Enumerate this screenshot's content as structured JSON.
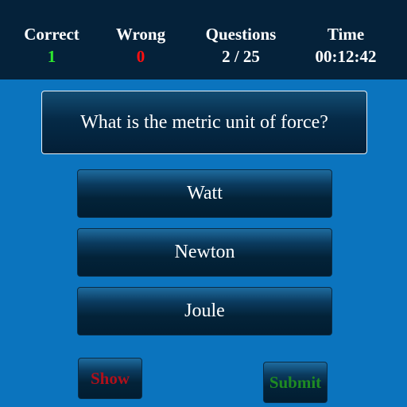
{
  "stats": {
    "correct": {
      "label": "Correct",
      "value": "1",
      "color": "#2ee82e"
    },
    "wrong": {
      "label": "Wrong",
      "value": "0",
      "color": "#ff1010"
    },
    "questions": {
      "label": "Questions",
      "value": "2 / 25",
      "color": "#ffffff"
    },
    "time": {
      "label": "Time",
      "value": "00:12:42",
      "color": "#ffffff"
    }
  },
  "question": {
    "text": "What is the metric unit of force?"
  },
  "answers": [
    {
      "label": "Watt"
    },
    {
      "label": "Newton"
    },
    {
      "label": "Joule"
    }
  ],
  "controls": {
    "show_label": "Show",
    "submit_label": "Submit"
  },
  "colors": {
    "background": "#0b74be",
    "topbar": "#05223a"
  }
}
